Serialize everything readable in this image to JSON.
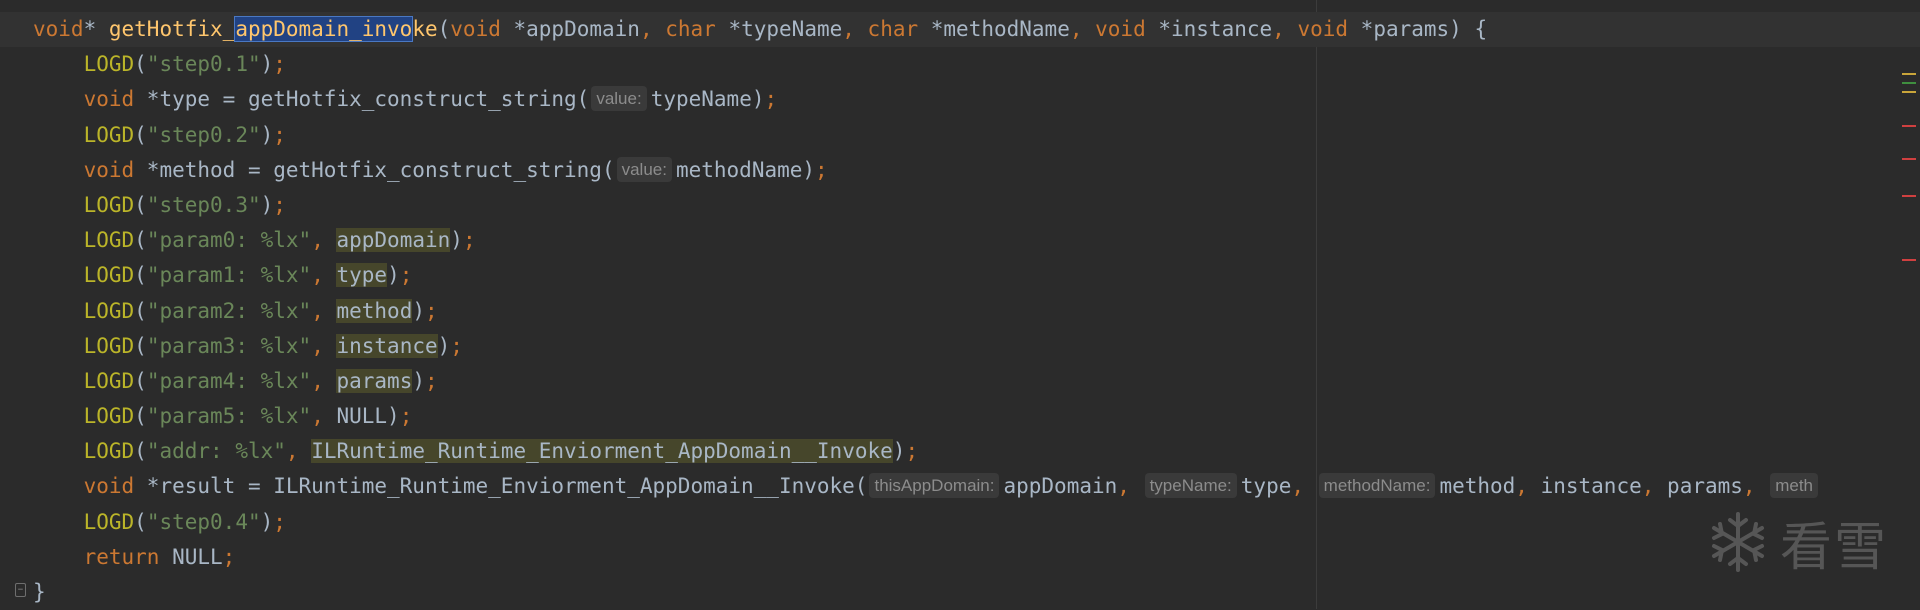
{
  "editor": {
    "lines": [
      {
        "parts": [
          [
            "kw",
            "void"
          ],
          [
            "plain",
            "* "
          ],
          [
            "fn",
            "getHotfix_"
          ],
          [
            "sel",
            "appDomain_invo"
          ],
          [
            "fn",
            "ke"
          ],
          [
            "plain",
            "("
          ],
          [
            "kw",
            "void"
          ],
          [
            "plain",
            " *appDomain"
          ],
          [
            "punc",
            ", "
          ],
          [
            "kw",
            "char"
          ],
          [
            "plain",
            " *typeName"
          ],
          [
            "punc",
            ", "
          ],
          [
            "kw",
            "char"
          ],
          [
            "plain",
            " *methodName"
          ],
          [
            "punc",
            ", "
          ],
          [
            "kw",
            "void"
          ],
          [
            "plain",
            " *instance"
          ],
          [
            "punc",
            ", "
          ],
          [
            "kw",
            "void"
          ],
          [
            "plain",
            " *params) {"
          ]
        ]
      },
      {
        "parts": [
          [
            "plain",
            "    "
          ],
          [
            "macro",
            "LOGD"
          ],
          [
            "plain",
            "("
          ],
          [
            "str",
            "\"step0.1\""
          ],
          [
            "plain",
            ")"
          ],
          [
            "punc",
            ";"
          ]
        ]
      },
      {
        "parts": [
          [
            "plain",
            "    "
          ],
          [
            "kw",
            "void"
          ],
          [
            "plain",
            " *type = getHotfix_construct_string("
          ],
          [
            "hint",
            "value:"
          ],
          [
            "plain",
            "typeName)"
          ],
          [
            "punc",
            ";"
          ]
        ]
      },
      {
        "parts": [
          [
            "plain",
            "    "
          ],
          [
            "macro",
            "LOGD"
          ],
          [
            "plain",
            "("
          ],
          [
            "str",
            "\"step0.2\""
          ],
          [
            "plain",
            ")"
          ],
          [
            "punc",
            ";"
          ]
        ]
      },
      {
        "parts": [
          [
            "plain",
            "    "
          ],
          [
            "kw",
            "void"
          ],
          [
            "plain",
            " *method = getHotfix_construct_string("
          ],
          [
            "hint",
            "value:"
          ],
          [
            "plain",
            "methodName)"
          ],
          [
            "punc",
            ";"
          ]
        ]
      },
      {
        "parts": [
          [
            "plain",
            "    "
          ],
          [
            "macro",
            "LOGD"
          ],
          [
            "plain",
            "("
          ],
          [
            "str",
            "\"step0.3\""
          ],
          [
            "plain",
            ")"
          ],
          [
            "punc",
            ";"
          ]
        ]
      },
      {
        "parts": [
          [
            "plain",
            "    "
          ],
          [
            "macro",
            "LOGD"
          ],
          [
            "plain",
            "("
          ],
          [
            "str",
            "\"param0: %lx\""
          ],
          [
            "punc",
            ", "
          ],
          [
            "usage",
            "appDomain"
          ],
          [
            "plain",
            ")"
          ],
          [
            "punc",
            ";"
          ]
        ]
      },
      {
        "parts": [
          [
            "plain",
            "    "
          ],
          [
            "macro",
            "LOGD"
          ],
          [
            "plain",
            "("
          ],
          [
            "str",
            "\"param1: %lx\""
          ],
          [
            "punc",
            ", "
          ],
          [
            "usage",
            "type"
          ],
          [
            "plain",
            ")"
          ],
          [
            "punc",
            ";"
          ]
        ]
      },
      {
        "parts": [
          [
            "plain",
            "    "
          ],
          [
            "macro",
            "LOGD"
          ],
          [
            "plain",
            "("
          ],
          [
            "str",
            "\"param2: %lx\""
          ],
          [
            "punc",
            ", "
          ],
          [
            "usage",
            "method"
          ],
          [
            "plain",
            ")"
          ],
          [
            "punc",
            ";"
          ]
        ]
      },
      {
        "parts": [
          [
            "plain",
            "    "
          ],
          [
            "macro",
            "LOGD"
          ],
          [
            "plain",
            "("
          ],
          [
            "str",
            "\"param3: %lx\""
          ],
          [
            "punc",
            ", "
          ],
          [
            "usage",
            "instance"
          ],
          [
            "plain",
            ")"
          ],
          [
            "punc",
            ";"
          ]
        ]
      },
      {
        "parts": [
          [
            "plain",
            "    "
          ],
          [
            "macro",
            "LOGD"
          ],
          [
            "plain",
            "("
          ],
          [
            "str",
            "\"param4: %lx\""
          ],
          [
            "punc",
            ", "
          ],
          [
            "usage",
            "params"
          ],
          [
            "plain",
            ")"
          ],
          [
            "punc",
            ";"
          ]
        ]
      },
      {
        "parts": [
          [
            "plain",
            "    "
          ],
          [
            "macro",
            "LOGD"
          ],
          [
            "plain",
            "("
          ],
          [
            "str",
            "\"param5: %lx\""
          ],
          [
            "punc",
            ", "
          ],
          [
            "plain",
            "NULL)"
          ],
          [
            "punc",
            ";"
          ]
        ]
      },
      {
        "parts": [
          [
            "plain",
            "    "
          ],
          [
            "macro",
            "LOGD"
          ],
          [
            "plain",
            "("
          ],
          [
            "str",
            "\"addr: %lx\""
          ],
          [
            "punc",
            ", "
          ],
          [
            "usage",
            "ILRuntime_Runtime_Enviorment_AppDomain__Invoke"
          ],
          [
            "plain",
            ")"
          ],
          [
            "punc",
            ";"
          ]
        ]
      },
      {
        "parts": [
          [
            "plain",
            "    "
          ],
          [
            "kw",
            "void"
          ],
          [
            "plain",
            " *result = ILRuntime_Runtime_Enviorment_AppDomain__Invoke("
          ],
          [
            "hint",
            "thisAppDomain:"
          ],
          [
            "plain",
            "appDomain"
          ],
          [
            "punc",
            ", "
          ],
          [
            "hint",
            "typeName:"
          ],
          [
            "plain",
            "type"
          ],
          [
            "punc",
            ", "
          ],
          [
            "hint",
            "methodName:"
          ],
          [
            "plain",
            "method"
          ],
          [
            "punc",
            ", "
          ],
          [
            "plain",
            "instance"
          ],
          [
            "punc",
            ", "
          ],
          [
            "plain",
            "params"
          ],
          [
            "punc",
            ", "
          ],
          [
            "hint",
            "meth"
          ]
        ]
      },
      {
        "parts": [
          [
            "plain",
            "    "
          ],
          [
            "macro",
            "LOGD"
          ],
          [
            "plain",
            "("
          ],
          [
            "str",
            "\"step0.4\""
          ],
          [
            "plain",
            ")"
          ],
          [
            "punc",
            ";"
          ]
        ]
      },
      {
        "parts": [
          [
            "plain",
            "    "
          ],
          [
            "kw",
            "return"
          ],
          [
            "plain",
            " NULL"
          ],
          [
            "punc",
            ";"
          ]
        ]
      },
      {
        "parts": [
          [
            "plain",
            "}"
          ]
        ]
      }
    ],
    "current_line": 0
  },
  "scroll_marks": [
    {
      "color": "#c9a53a",
      "pos": 0.12
    },
    {
      "color": "#3f8f3f",
      "pos": 0.135
    },
    {
      "color": "#c9a53a",
      "pos": 0.15
    },
    {
      "color": "#d04040",
      "pos": 0.205
    },
    {
      "color": "#d04040",
      "pos": 0.26
    },
    {
      "color": "#d04040",
      "pos": 0.32
    },
    {
      "color": "#d04040",
      "pos": 0.425
    }
  ],
  "watermark": {
    "text": "看雪",
    "icon": "snowflake-icon"
  }
}
